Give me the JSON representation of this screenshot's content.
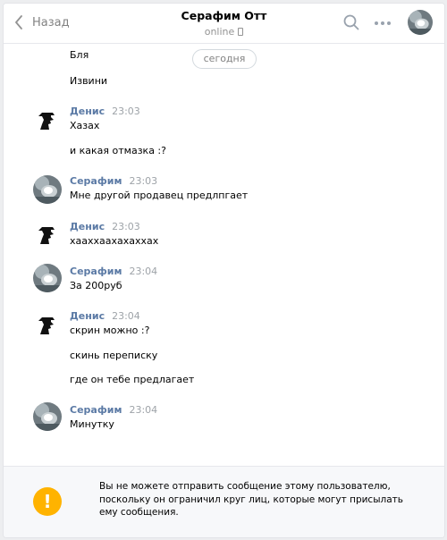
{
  "header": {
    "back_label": "Назад",
    "title": "Серафим Отт",
    "status": "online"
  },
  "date_divider": "сегодня",
  "messages": {
    "m1": {
      "text": "Бля"
    },
    "m2": {
      "text": "Извини"
    },
    "g1": {
      "sender": "Денис",
      "time": "23:03",
      "lines": [
        "Хазах",
        "и какая отмазка :?"
      ]
    },
    "g2": {
      "sender": "Серафим",
      "time": "23:03",
      "lines": [
        "Мне другой продавец предлпгает"
      ]
    },
    "g3": {
      "sender": "Денис",
      "time": "23:03",
      "lines": [
        "хааххаахахаххах"
      ]
    },
    "g4": {
      "sender": "Серафим",
      "time": "23:04",
      "lines": [
        "За 200руб"
      ]
    },
    "g5": {
      "sender": "Денис",
      "time": "23:04",
      "lines": [
        "скрин можно :?",
        "скинь переписку",
        "где он тебе предлагает"
      ]
    },
    "g6": {
      "sender": "Серафим",
      "time": "23:04",
      "lines": [
        "Минутку"
      ]
    }
  },
  "notice": {
    "icon_symbol": "!",
    "text": "Вы не можете отправить сообщение этому пользователю, поскольку он ограничил круг лиц, которые могут присылать ему сообщения."
  },
  "colors": {
    "sender_name": "#5b7aa5",
    "time": "#9ea3a8",
    "warning": "#ffb300",
    "background": "#edeef0"
  },
  "icons": [
    "back-chevron-icon",
    "search-icon",
    "more-icon",
    "phone-icon",
    "warning-icon"
  ]
}
